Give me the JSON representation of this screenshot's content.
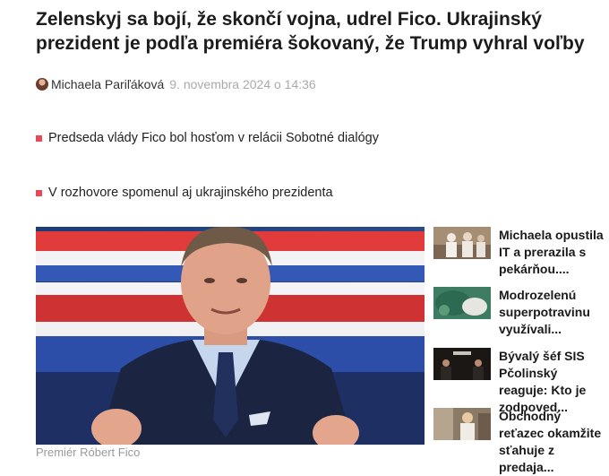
{
  "article": {
    "headline": "Zelenskyj sa bojí, že skončí vojna, udrel Fico. Ukrajinský prezident je podľa premiéra šokovaný, že Trump vyhral voľby",
    "author": "Michaela Pariľáková",
    "date": "9. novembra 2024 o 14:36",
    "bullets": [
      "Predseda vlády Fico bol hosťom v relácii Sobotné dialógy",
      "V rozhovore spomenul aj ukrajinského prezidenta"
    ],
    "image_caption": "Premiér Róbert Fico"
  },
  "sidebar": {
    "items": [
      {
        "title": "Michaela opustila IT a prerazila s pekárňou...."
      },
      {
        "title": "Modrozelenú superpotravinu využívali..."
      },
      {
        "title": "Bývalý šéf SIS Pčolinský reaguje: Kto je zodpoved..."
      },
      {
        "title": "Obchodný reťazec okamžite sťahuje z predaja..."
      }
    ]
  },
  "colors": {
    "bullet_accent": "#e8495a",
    "date_gray": "#aaaaaa"
  }
}
